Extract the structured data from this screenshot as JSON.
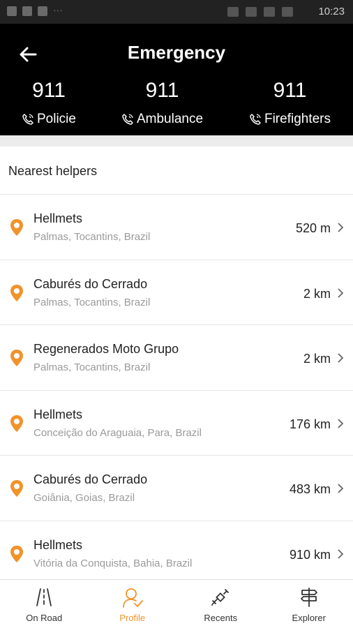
{
  "status_bar": {
    "time": "10:23"
  },
  "header": {
    "title": "Emergency",
    "numbers": [
      {
        "number": "911",
        "label": "Policie"
      },
      {
        "number": "911",
        "label": "Ambulance"
      },
      {
        "number": "911",
        "label": "Firefighters"
      }
    ]
  },
  "section": {
    "title": "Nearest helpers"
  },
  "helpers": [
    {
      "name": "Hellmets",
      "location": "Palmas, Tocantins, Brazil",
      "distance": "520 m"
    },
    {
      "name": "Caburés do Cerrado",
      "location": "Palmas, Tocantins, Brazil",
      "distance": "2 km"
    },
    {
      "name": "Regenerados Moto Grupo",
      "location": "Palmas, Tocantins, Brazil",
      "distance": "2 km"
    },
    {
      "name": "Hellmets",
      "location": "Conceição do Araguaia, Para, Brazil",
      "distance": "176 km"
    },
    {
      "name": "Caburés do Cerrado",
      "location": "Goiânia, Goias, Brazil",
      "distance": "483 km"
    },
    {
      "name": "Hellmets",
      "location": "Vitória da Conquista, Bahia, Brazil",
      "distance": "910 km"
    }
  ],
  "tabs": [
    {
      "label": "On Road",
      "icon": "road-icon",
      "active": false
    },
    {
      "label": "Profile",
      "icon": "profile-icon",
      "active": true
    },
    {
      "label": "Recents",
      "icon": "satellite-icon",
      "active": false
    },
    {
      "label": "Explorer",
      "icon": "signpost-icon",
      "active": false
    }
  ],
  "colors": {
    "accent": "#f0932b",
    "header_bg": "#000000",
    "status_bar_bg": "#222222"
  }
}
